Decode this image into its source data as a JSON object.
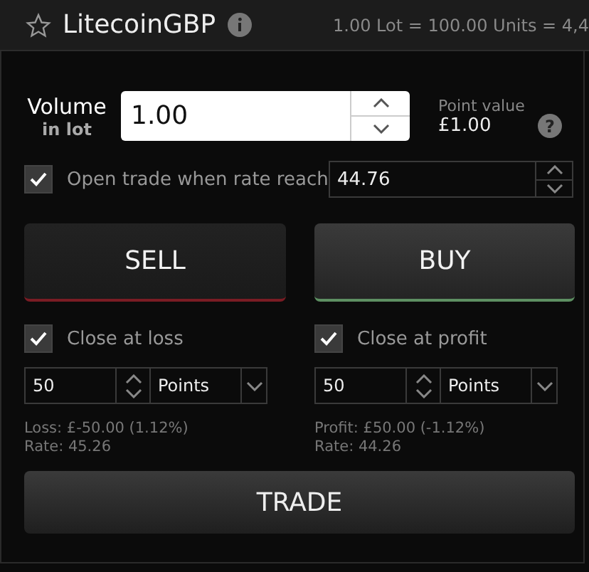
{
  "header": {
    "title": "LitecoinGBP",
    "starred": false,
    "summary": "1.00 Lot = 100.00 Units = 4,4"
  },
  "volume": {
    "label": "Volume",
    "sublabel": "in lot",
    "value": "1.00",
    "point_value_label": "Point value",
    "point_value": "£1.00",
    "help": "?"
  },
  "open_trade": {
    "label": "Open trade when rate reach",
    "checked": true,
    "value": "44.76"
  },
  "sides": [
    {
      "label": "SELL",
      "selected": false,
      "color": "#7a1c24"
    },
    {
      "label": "BUY",
      "selected": true,
      "color": "#5d8f62"
    }
  ],
  "closers": [
    {
      "label": "Close at loss",
      "checked": true,
      "value": "50",
      "unit": "Points",
      "result": "Loss: £-50.00 (1.12%)",
      "rate": "Rate: 45.26"
    },
    {
      "label": "Close at profit",
      "checked": true,
      "value": "50",
      "unit": "Points",
      "result": "Profit: £50.00 (-1.12%)",
      "rate": "Rate: 44.26"
    }
  ],
  "trade_button": "TRADE"
}
